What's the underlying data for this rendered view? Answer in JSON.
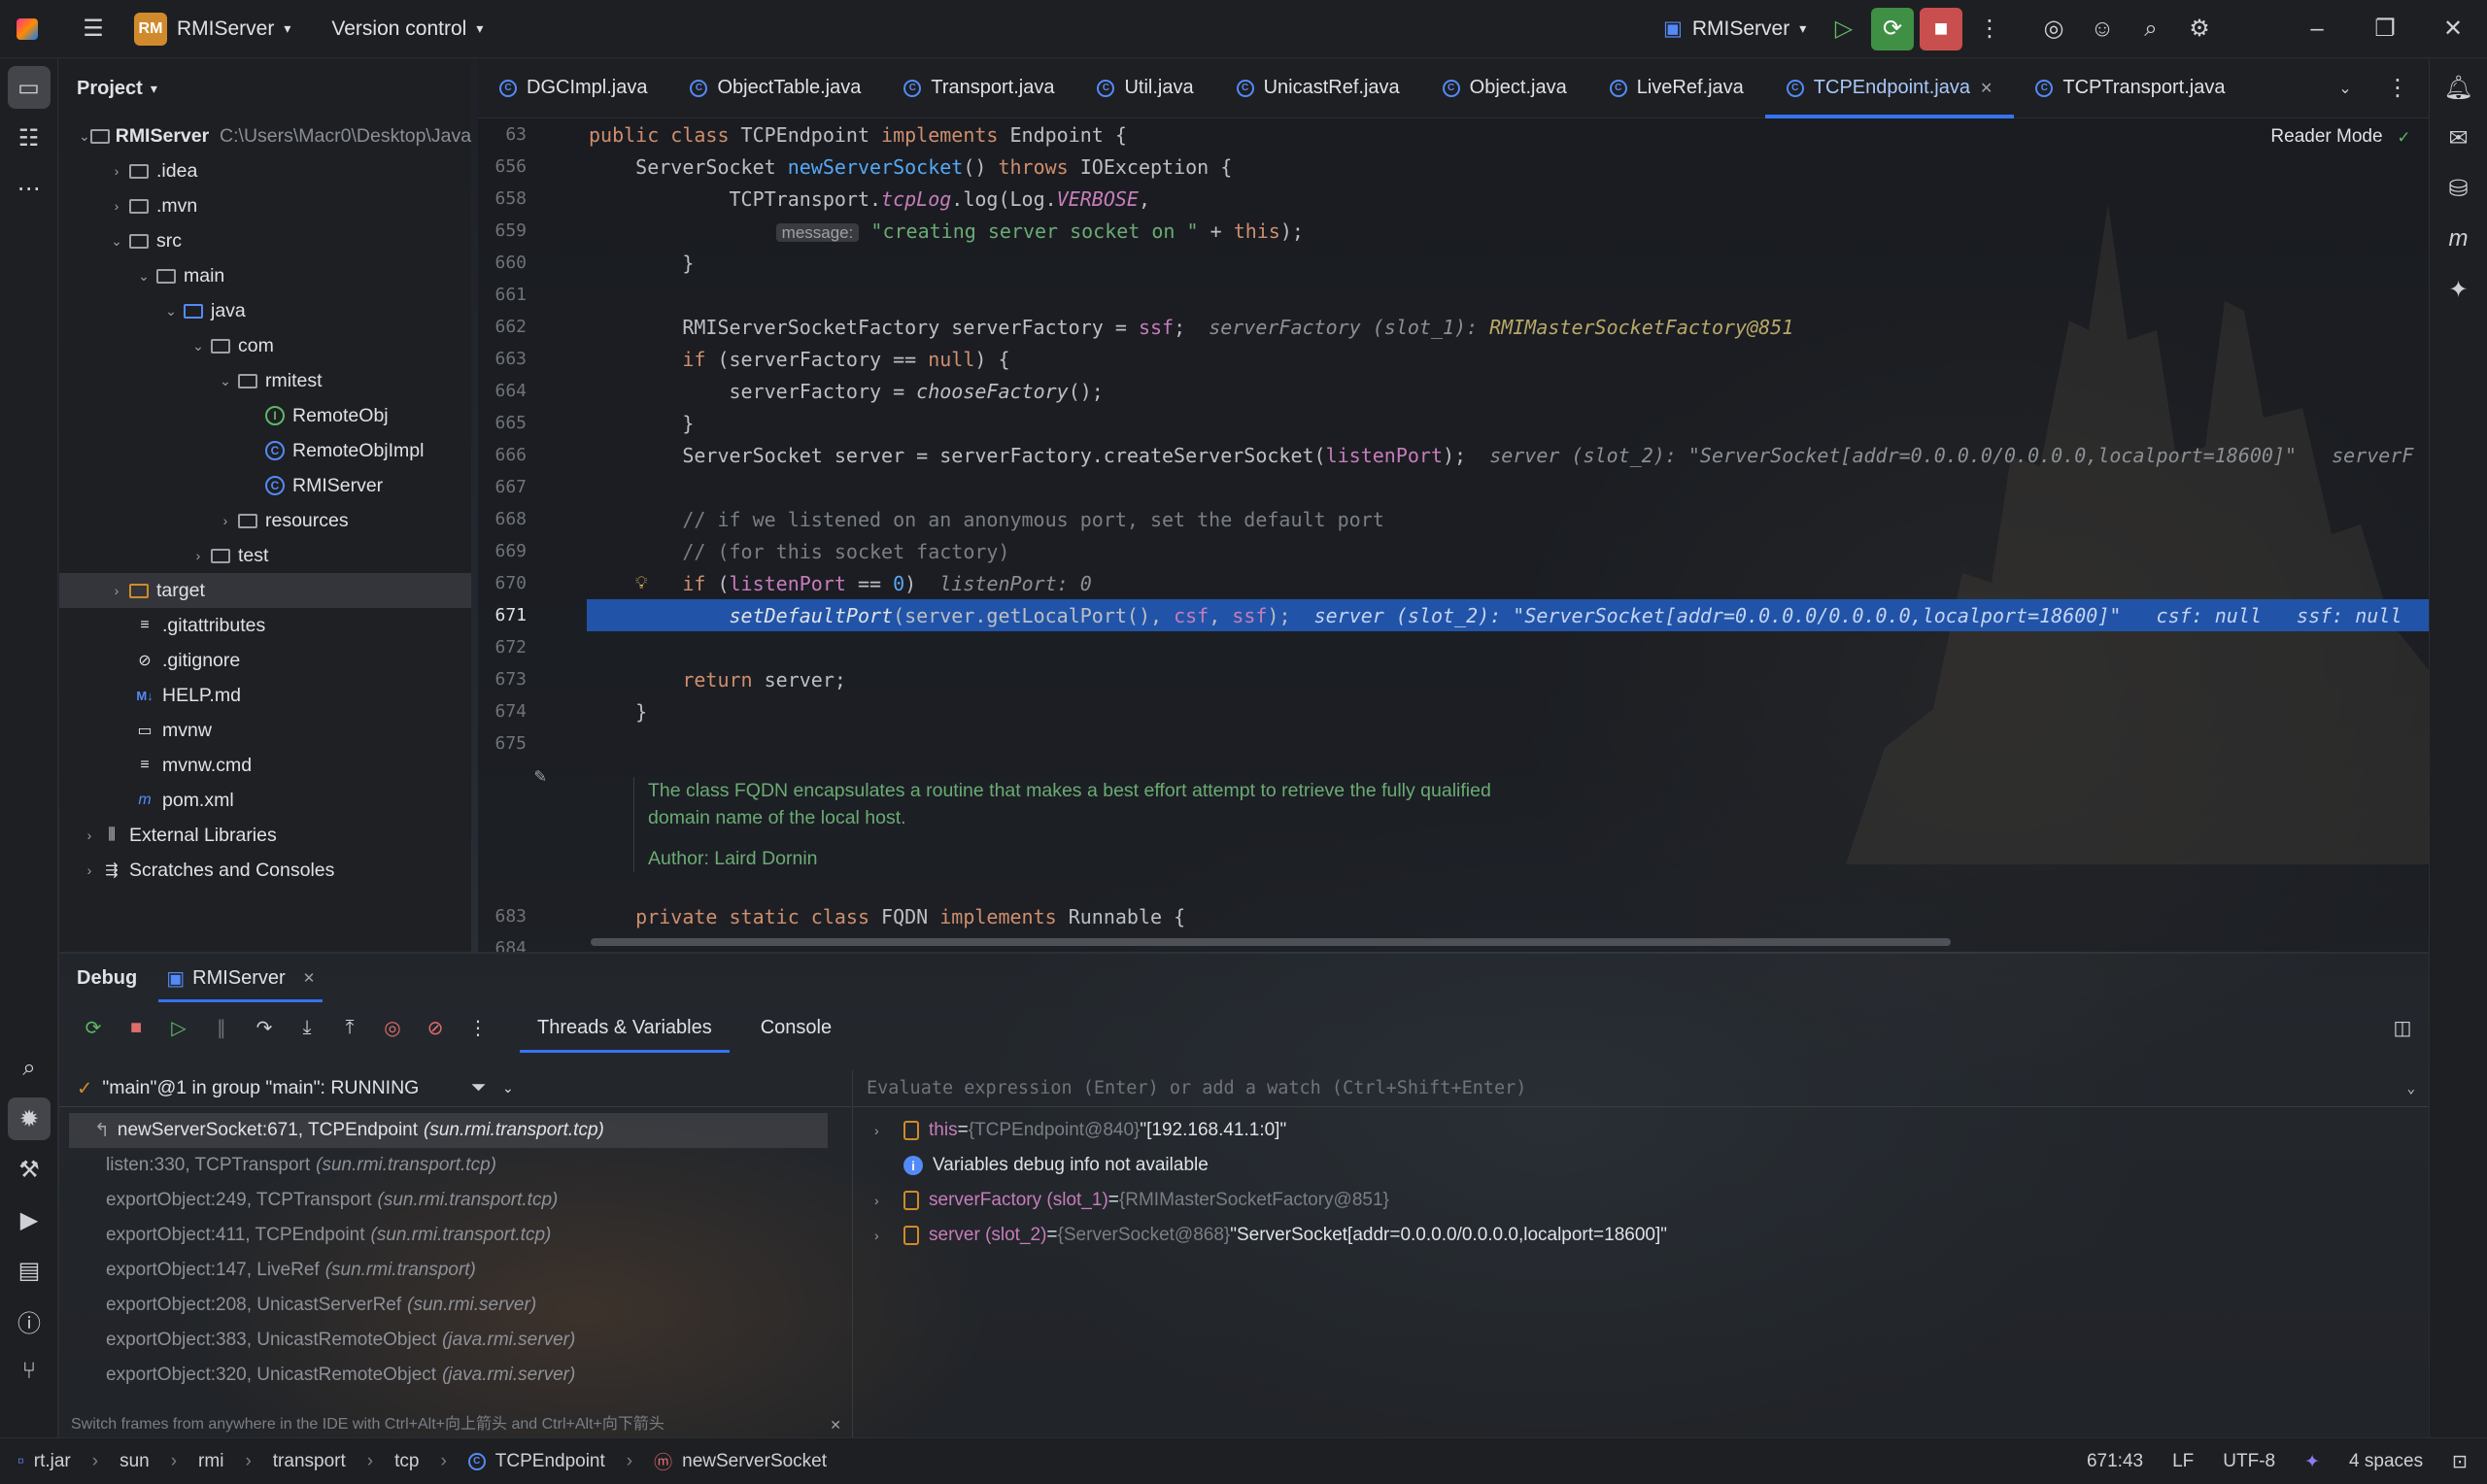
{
  "titlebar": {
    "project_badge": "RM",
    "project": "RMIServer",
    "vcs": "Version control",
    "run_config": "RMIServer"
  },
  "project_panel": {
    "title": "Project",
    "items": [
      {
        "name": "RMIServer",
        "path": "C:\\Users\\Macr0\\Desktop\\Java"
      },
      {
        "name": ".idea"
      },
      {
        "name": ".mvn"
      },
      {
        "name": "src"
      },
      {
        "name": "main"
      },
      {
        "name": "java"
      },
      {
        "name": "com"
      },
      {
        "name": "rmitest"
      },
      {
        "name": "RemoteObj"
      },
      {
        "name": "RemoteObjImpl"
      },
      {
        "name": "RMIServer"
      },
      {
        "name": "resources"
      },
      {
        "name": "test"
      },
      {
        "name": "target"
      },
      {
        "name": ".gitattributes"
      },
      {
        "name": ".gitignore"
      },
      {
        "name": "HELP.md"
      },
      {
        "name": "mvnw"
      },
      {
        "name": "mvnw.cmd"
      },
      {
        "name": "pom.xml"
      },
      {
        "name": "External Libraries"
      },
      {
        "name": "Scratches and Consoles"
      }
    ]
  },
  "tabs": [
    "DGCImpl.java",
    "ObjectTable.java",
    "Transport.java",
    "Util.java",
    "UnicastRef.java",
    "Object.java",
    "LiveRef.java",
    "TCPEndpoint.java",
    "TCPTransport.java"
  ],
  "editor": {
    "reader_mode": "Reader Mode",
    "lines": {
      "l63": "63",
      "l656": "656",
      "l658": "658",
      "l659": "659",
      "l660": "660",
      "l661": "661",
      "l662": "662",
      "l663": "663",
      "l664": "664",
      "l665": "665",
      "l666": "666",
      "l667": "667",
      "l668": "668",
      "l669": "669",
      "l670": "670",
      "l671": "671",
      "l672": "672",
      "l673": "673",
      "l674": "674",
      "l675": "675",
      "l683": "683",
      "l684": "684"
    },
    "doc": {
      "text": "The class FQDN encapsulates a routine that makes a best effort attempt to retrieve the fully qualified domain name of the local host.",
      "author": "Author: Laird Dornin"
    }
  },
  "debug": {
    "title": "Debug",
    "session": "RMIServer",
    "tab_threads": "Threads & Variables",
    "tab_console": "Console",
    "thread": "\"main\"@1 in group \"main\": RUNNING",
    "frames": [
      {
        "m": "newServerSocket:671, TCPEndpoint",
        "p": "(sun.rmi.transport.tcp)"
      },
      {
        "m": "listen:330, TCPTransport",
        "p": "(sun.rmi.transport.tcp)"
      },
      {
        "m": "exportObject:249, TCPTransport",
        "p": "(sun.rmi.transport.tcp)"
      },
      {
        "m": "exportObject:411, TCPEndpoint",
        "p": "(sun.rmi.transport.tcp)"
      },
      {
        "m": "exportObject:147, LiveRef",
        "p": "(sun.rmi.transport)"
      },
      {
        "m": "exportObject:208, UnicastServerRef",
        "p": "(sun.rmi.server)"
      },
      {
        "m": "exportObject:383, UnicastRemoteObject",
        "p": "(java.rmi.server)"
      },
      {
        "m": "exportObject:320, UnicastRemoteObject",
        "p": "(java.rmi.server)"
      }
    ],
    "hint": "Switch frames from anywhere in the IDE with Ctrl+Alt+向上箭头 and Ctrl+Alt+向下箭头",
    "eval_placeholder": "Evaluate expression (Enter) or add a watch (Ctrl+Shift+Enter)",
    "vars": [
      {
        "name": "this",
        "eq": " = ",
        "type": "{TCPEndpoint@840}",
        "val": " \"[192.168.41.1:0]\""
      },
      {
        "info": "Variables debug info not available"
      },
      {
        "name": "serverFactory (slot_1)",
        "eq": " = ",
        "type": "{RMIMasterSocketFactory@851}",
        "val": ""
      },
      {
        "name": "server (slot_2)",
        "eq": " = ",
        "type": "{ServerSocket@868}",
        "val": " \"ServerSocket[addr=0.0.0.0/0.0.0.0,localport=18600]\""
      }
    ]
  },
  "status": {
    "crumbs": [
      "rt.jar",
      "sun",
      "rmi",
      "transport",
      "tcp",
      "TCPEndpoint",
      "newServerSocket"
    ],
    "pos": "671:43",
    "eol": "LF",
    "enc": "UTF-8",
    "indent": "4 spaces"
  }
}
